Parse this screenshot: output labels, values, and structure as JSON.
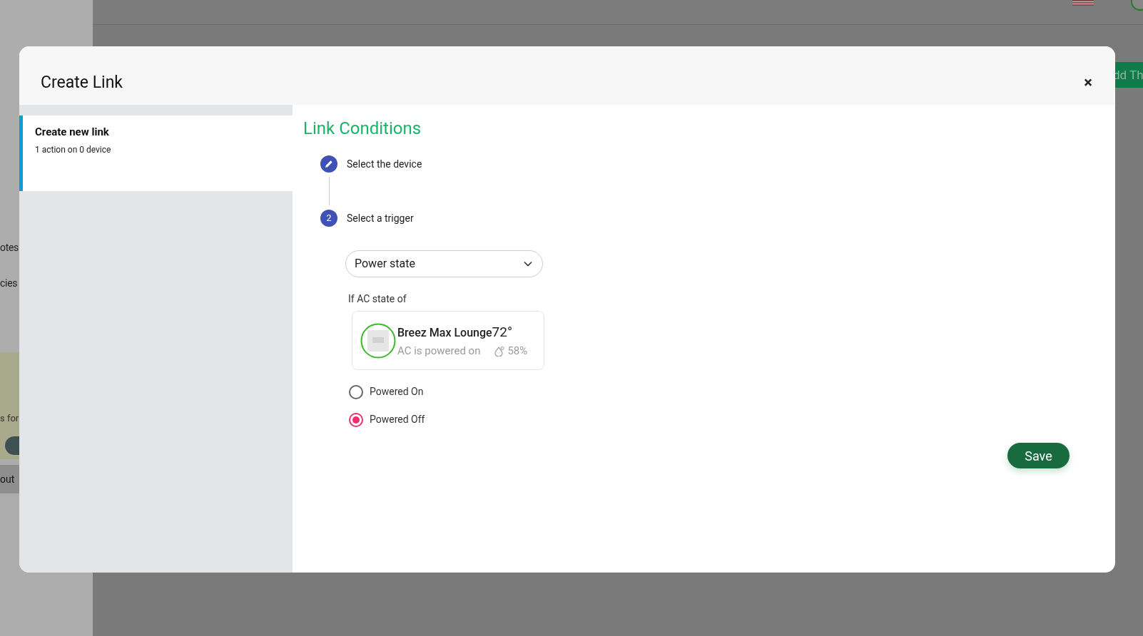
{
  "background": {
    "menu_items": [
      "otes",
      "cies"
    ],
    "banner_text": "s for",
    "logout": "out",
    "add_button": "dd Th"
  },
  "dialog": {
    "title": "Create Link",
    "close": "×",
    "sidebar": {
      "items": [
        {
          "title": "Create new link",
          "subtitle": "1 action on 0 device",
          "selected": true
        }
      ]
    },
    "heading": "Link Conditions",
    "steps": [
      {
        "kind": "edit",
        "label": "Select the device"
      },
      {
        "kind": "number",
        "number": "2",
        "label": "Select a trigger"
      }
    ],
    "trigger_select": {
      "value": "Power state"
    },
    "condition_label": "If AC state of",
    "device": {
      "name": "Breez Max Lounge",
      "temperature": "72°",
      "status": "AC is powered on",
      "humidity": "58%"
    },
    "options": [
      {
        "label": "Powered On",
        "selected": false
      },
      {
        "label": "Powered Off",
        "selected": true
      }
    ],
    "save": "Save"
  }
}
